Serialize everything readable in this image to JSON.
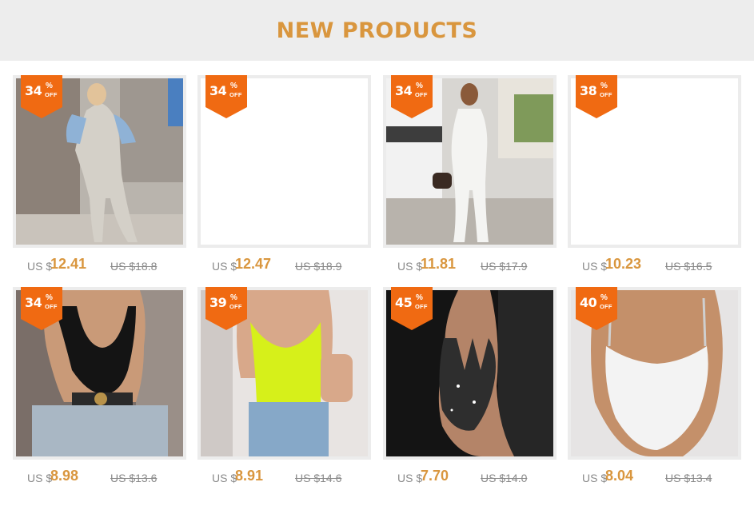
{
  "header": {
    "title": "NEW PRODUCTS"
  },
  "products": [
    {
      "discount": "34",
      "percent": "%",
      "off": "OFF",
      "currency": "US $",
      "price": "12.41",
      "old_price": "US $18.8",
      "image": "grey-jumpsuit-denim-jacket"
    },
    {
      "discount": "34",
      "percent": "%",
      "off": "OFF",
      "currency": "US $",
      "price": "12.47",
      "old_price": "US $18.9",
      "image": "blank"
    },
    {
      "discount": "34",
      "percent": "%",
      "off": "OFF",
      "currency": "US $",
      "price": "11.81",
      "old_price": "US $17.9",
      "image": "white-jumpsuit-street"
    },
    {
      "discount": "38",
      "percent": "%",
      "off": "OFF",
      "currency": "US $",
      "price": "10.23",
      "old_price": "US $16.5",
      "image": "blank"
    },
    {
      "discount": "34",
      "percent": "%",
      "off": "OFF",
      "currency": "US $",
      "price": "8.98",
      "old_price": "US $13.6",
      "image": "black-leather-bodysuit"
    },
    {
      "discount": "39",
      "percent": "%",
      "off": "OFF",
      "currency": "US $",
      "price": "8.91",
      "old_price": "US $14.6",
      "image": "neon-yellow-satin-bodysuit"
    },
    {
      "discount": "45",
      "percent": "%",
      "off": "OFF",
      "currency": "US $",
      "price": "7.70",
      "old_price": "US $14.0",
      "image": "black-sparkle-lace-up-bodysuit"
    },
    {
      "discount": "40",
      "percent": "%",
      "off": "OFF",
      "currency": "US $",
      "price": "8.04",
      "old_price": "US $13.4",
      "image": "white-strappy-bodysuit"
    }
  ],
  "colors": {
    "accent": "#d9963e",
    "badge": "#f06a12",
    "header_bg": "#ededed",
    "frame": "#ececec",
    "muted": "#8a8a8a"
  }
}
